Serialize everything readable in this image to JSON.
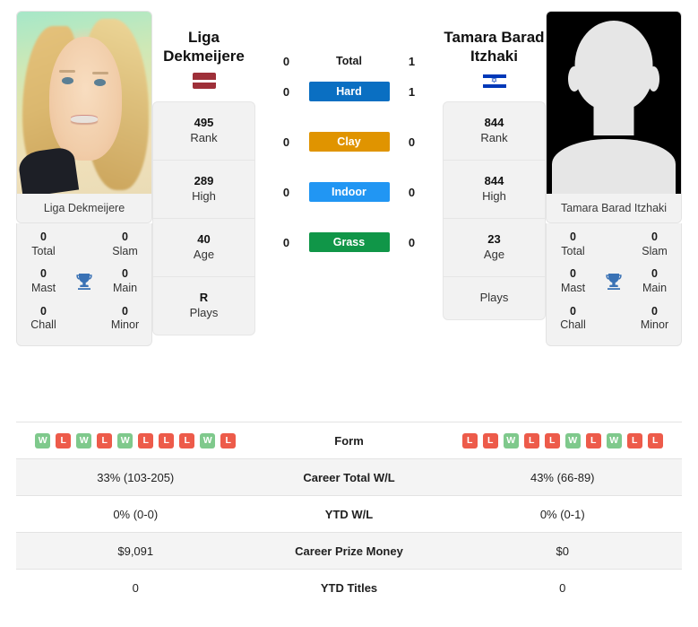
{
  "players": {
    "left": {
      "name": "Liga Dekmeijere",
      "name_line1": "Liga",
      "name_line2": "Dekmeijere",
      "country_flag": "latvia-flag",
      "photo": "player-photo-liga-dekmeijere",
      "caption": "Liga Dekmeijere",
      "boxes": [
        {
          "num": "495",
          "lbl": "Rank"
        },
        {
          "num": "289",
          "lbl": "High"
        },
        {
          "num": "40",
          "lbl": "Age"
        },
        {
          "num": "R",
          "lbl": "Plays"
        }
      ],
      "titles": [
        {
          "num": "0",
          "lbl": "Total"
        },
        {
          "num": "0",
          "lbl": "Slam"
        },
        {
          "num": "0",
          "lbl": "Mast"
        },
        {
          "num": "0",
          "lbl": "Main"
        },
        {
          "num": "0",
          "lbl": "Chall"
        },
        {
          "num": "0",
          "lbl": "Minor"
        }
      ],
      "form": [
        "W",
        "L",
        "W",
        "L",
        "W",
        "L",
        "L",
        "L",
        "W",
        "L"
      ],
      "career_total_wl": "33% (103-205)",
      "ytd_wl": "0% (0-0)",
      "career_prize_money": "$9,091",
      "ytd_titles": "0"
    },
    "right": {
      "name": "Tamara Barad Itzhaki",
      "name_line1": "Tamara Barad",
      "name_line2": "Itzhaki",
      "country_flag": "israel-flag",
      "photo": "player-photo-placeholder-silhouette",
      "caption": "Tamara Barad Itzhaki",
      "boxes": [
        {
          "num": "844",
          "lbl": "Rank"
        },
        {
          "num": "844",
          "lbl": "High"
        },
        {
          "num": "23",
          "lbl": "Age"
        },
        {
          "num": "",
          "lbl": "Plays"
        }
      ],
      "titles": [
        {
          "num": "0",
          "lbl": "Total"
        },
        {
          "num": "0",
          "lbl": "Slam"
        },
        {
          "num": "0",
          "lbl": "Mast"
        },
        {
          "num": "0",
          "lbl": "Main"
        },
        {
          "num": "0",
          "lbl": "Chall"
        },
        {
          "num": "0",
          "lbl": "Minor"
        }
      ],
      "form": [
        "L",
        "L",
        "W",
        "L",
        "L",
        "W",
        "L",
        "W",
        "L",
        "L"
      ],
      "career_total_wl": "43% (66-89)",
      "ytd_wl": "0% (0-1)",
      "career_prize_money": "$0",
      "ytd_titles": "0"
    }
  },
  "h2h": {
    "rows": [
      {
        "label": "Total",
        "left": "0",
        "right": "1",
        "color": ""
      },
      {
        "label": "Hard",
        "left": "0",
        "right": "1",
        "color": "#0a6fc2"
      },
      {
        "label": "Clay",
        "left": "0",
        "right": "0",
        "color": "#e09400"
      },
      {
        "label": "Indoor",
        "left": "0",
        "right": "0",
        "color": "#2196f3"
      },
      {
        "label": "Grass",
        "left": "0",
        "right": "0",
        "color": "#109648"
      }
    ]
  },
  "table": {
    "rows": [
      {
        "label": "Form",
        "type": "form"
      },
      {
        "label": "Career Total W/L",
        "type": "text",
        "key": "career_total_wl"
      },
      {
        "label": "YTD W/L",
        "type": "text",
        "key": "ytd_wl"
      },
      {
        "label": "Career Prize Money",
        "type": "text",
        "key": "career_prize_money"
      },
      {
        "label": "YTD Titles",
        "type": "text",
        "key": "ytd_titles"
      }
    ]
  },
  "icons": {
    "trophy": "trophy-icon",
    "star_of_david": "✡"
  },
  "colors": {
    "hard": "#0a6fc2",
    "clay": "#e09400",
    "indoor": "#2196f3",
    "grass": "#109648",
    "win_badge": "#7fc98c",
    "loss_badge": "#ed5b4a",
    "trophy": "#3a72b5",
    "panel": "#f2f2f2"
  }
}
